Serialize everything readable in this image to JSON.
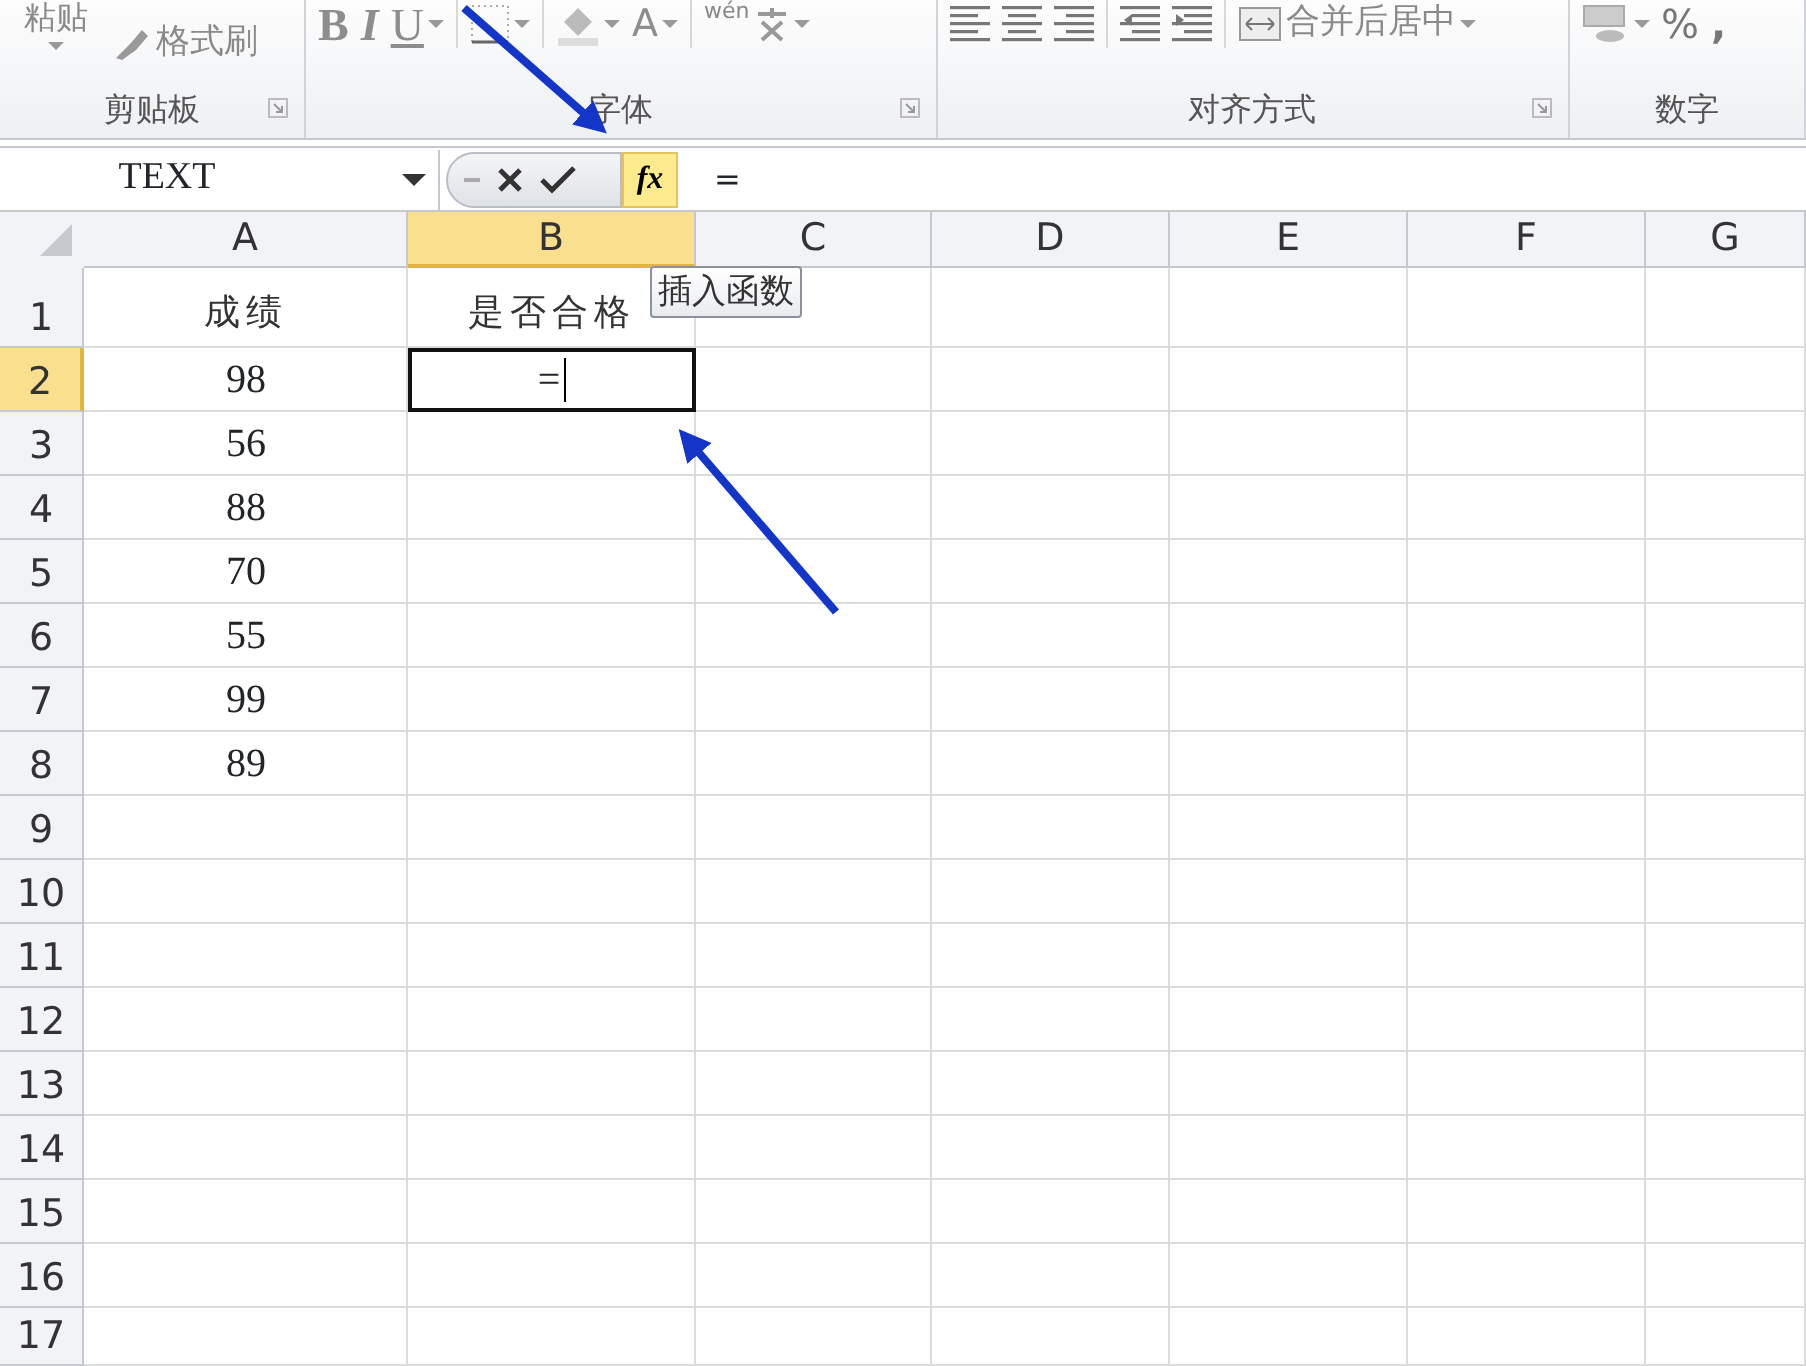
{
  "ribbon": {
    "groups": [
      {
        "label": "剪贴板",
        "launcher": true,
        "items": [
          {
            "kind": "paste",
            "text": "粘贴",
            "dropdown": true
          },
          {
            "kind": "format_painter",
            "text": "格式刷"
          }
        ]
      },
      {
        "label": "字体",
        "launcher": true,
        "items": [
          {
            "kind": "bold",
            "text": "B"
          },
          {
            "kind": "italic",
            "text": "I"
          },
          {
            "kind": "underline",
            "text": "U",
            "dropdown": true
          },
          {
            "kind": "borders",
            "dropdown": true
          },
          {
            "kind": "fill_color",
            "dropdown": true
          },
          {
            "kind": "font_color",
            "text": "A",
            "dropdown": true
          },
          {
            "kind": "phonetic",
            "text": "wén",
            "dropdown": true
          }
        ]
      },
      {
        "label": "对齐方式",
        "launcher": true,
        "items": [
          {
            "kind": "align_left"
          },
          {
            "kind": "align_center"
          },
          {
            "kind": "align_right"
          },
          {
            "kind": "outdent"
          },
          {
            "kind": "indent"
          },
          {
            "kind": "merge",
            "text": "合并后居中",
            "dropdown": true
          }
        ]
      },
      {
        "label": "数字",
        "launcher": false,
        "items": [
          {
            "kind": "currency",
            "dropdown": true
          },
          {
            "kind": "percent",
            "text": "%"
          },
          {
            "kind": "comma",
            "text": ","
          }
        ]
      }
    ]
  },
  "formula_bar": {
    "name_box": "TEXT",
    "insert_function": {
      "label": "fx",
      "highlighted": true
    },
    "content": "="
  },
  "tooltip": "插入函数",
  "sheet": {
    "columns": [
      {
        "label": "A",
        "selected": false
      },
      {
        "label": "B",
        "selected": true
      },
      {
        "label": "C",
        "selected": false
      },
      {
        "label": "D",
        "selected": false
      },
      {
        "label": "E",
        "selected": false
      },
      {
        "label": "F",
        "selected": false
      },
      {
        "label": "G",
        "selected": false
      }
    ],
    "rows": [
      {
        "label": "1",
        "selected": false,
        "cells": [
          {
            "text": "成绩",
            "active": false
          },
          {
            "text": "是否合格",
            "active": false
          }
        ]
      },
      {
        "label": "2",
        "selected": true,
        "cells": [
          {
            "text": "98",
            "active": false
          },
          {
            "text": "=",
            "active": true
          }
        ]
      },
      {
        "label": "3",
        "selected": false,
        "cells": [
          {
            "text": "56",
            "active": false
          }
        ]
      },
      {
        "label": "4",
        "selected": false,
        "cells": [
          {
            "text": "88",
            "active": false
          }
        ]
      },
      {
        "label": "5",
        "selected": false,
        "cells": [
          {
            "text": "70",
            "active": false
          }
        ]
      },
      {
        "label": "6",
        "selected": false,
        "cells": [
          {
            "text": "55",
            "active": false
          }
        ]
      },
      {
        "label": "7",
        "selected": false,
        "cells": [
          {
            "text": "99",
            "active": false
          }
        ]
      },
      {
        "label": "8",
        "selected": false,
        "cells": [
          {
            "text": "89",
            "active": false
          }
        ]
      },
      {
        "label": "9",
        "selected": false
      },
      {
        "label": "10",
        "selected": false
      },
      {
        "label": "11",
        "selected": false
      },
      {
        "label": "12",
        "selected": false
      },
      {
        "label": "13",
        "selected": false
      },
      {
        "label": "14",
        "selected": false
      },
      {
        "label": "15",
        "selected": false
      },
      {
        "label": "16",
        "selected": false
      },
      {
        "label": "17",
        "selected": false
      }
    ]
  }
}
